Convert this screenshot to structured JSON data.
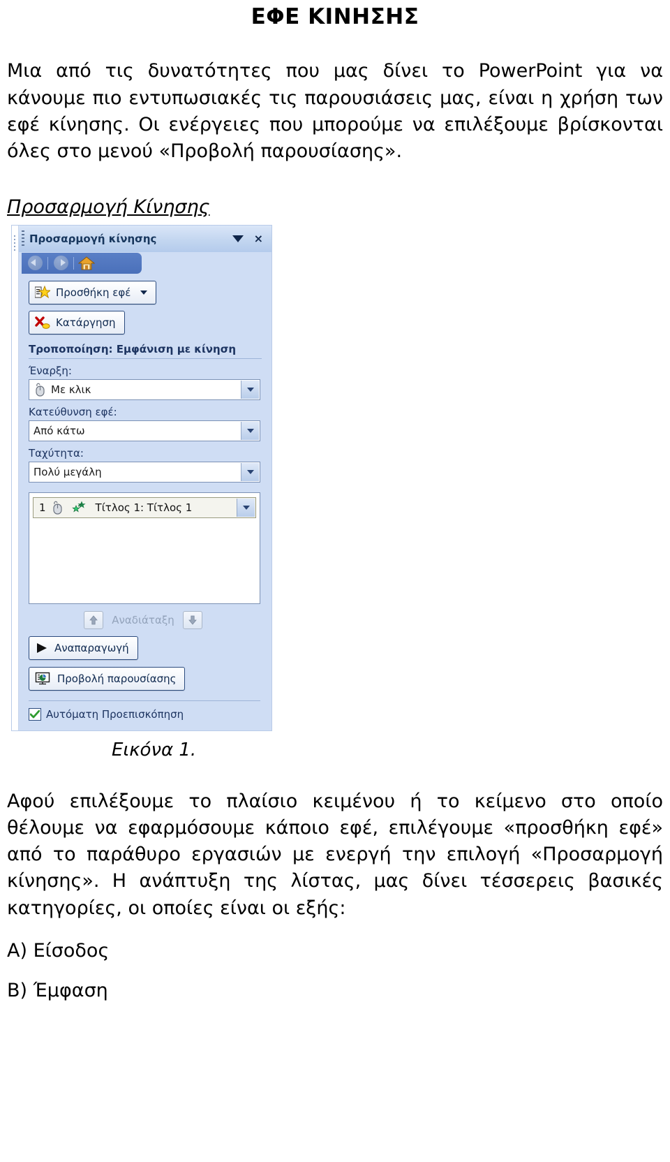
{
  "document": {
    "title": "ΕΦΕ ΚΙΝΗΣΗΣ",
    "intro_paragraph": "Μια από τις δυνατότητες που μας δίνει το PowerPoint για να κάνουμε πιο εντυπωσιακές τις παρουσιάσεις μας, είναι η χρήση των εφέ κίνησης. Οι ενέργειες που μπορούμε να επιλέξουμε βρίσκονται όλες στο μενού «Προβολή παρουσίασης».",
    "section_heading": "Προσαρμογή Κίνησης",
    "figure_caption": "Εικόνα 1.",
    "second_paragraph": "Αφού επιλέξουμε το πλαίσιο κειμένου ή το κείμενο στο οποίο θέλουμε να εφαρμόσουμε κάποιο εφέ, επιλέγουμε «προσθήκη εφέ» από το παράθυρο εργασιών με ενεργή την επιλογή «Προσαρμογή κίνησης». Η ανάπτυξη της λίστας, μας δίνει τέσσερεις βασικές κατηγορίες, οι οποίες είναι οι εξής:",
    "category_a": "Α) Είσοδος",
    "category_b": "Β) Έμφαση"
  },
  "task_pane": {
    "title": "Προσαρμογή κίνησης",
    "close_glyph": "×",
    "navbar": {
      "back_icon": "back-arrow-icon",
      "forward_icon": "forward-arrow-icon",
      "home_icon": "home-icon"
    },
    "add_effect_button": {
      "label": "Προσθήκη εφέ",
      "icon": "add-effect-star-icon"
    },
    "remove_button": {
      "label": "Κατάργηση",
      "icon": "remove-effect-icon"
    },
    "modify_heading": "Τροποποίηση: Εμφάνιση με κίνηση",
    "fields": [
      {
        "label": "Έναρξη:",
        "value": "Με κλικ",
        "icon": "mouse-click-icon"
      },
      {
        "label": "Κατεύθυνση εφέ:",
        "value": "Από κάτω",
        "icon": ""
      },
      {
        "label": "Ταχύτητα:",
        "value": "Πολύ μεγάλη",
        "icon": ""
      }
    ],
    "animation_list": {
      "items": [
        {
          "order": "1",
          "trigger_icon": "mouse-click-icon",
          "effect_icon": "green-star-entrance-icon",
          "label": "Τίτλος 1: Τίτλος 1"
        }
      ]
    },
    "reorder": {
      "label": "Αναδιάταξη",
      "up_icon": "arrow-up-icon",
      "down_icon": "arrow-down-icon"
    },
    "play_button": {
      "label": "Αναπαραγωγή",
      "icon": "play-triangle-icon"
    },
    "slideshow_button": {
      "label": "Προβολή παρουσίασης",
      "icon": "slideshow-screen-icon"
    },
    "autopreview": {
      "label": "Αυτόματη Προεπισκόπηση",
      "checked": true,
      "check_glyph": "✔"
    }
  },
  "colors": {
    "pane_background": "#cfddf4",
    "titlebar_blue": "#c3d6f0",
    "navbar_blue": "#4a70ba",
    "title_text": "#17365d",
    "check_green": "#2e9b2e"
  }
}
